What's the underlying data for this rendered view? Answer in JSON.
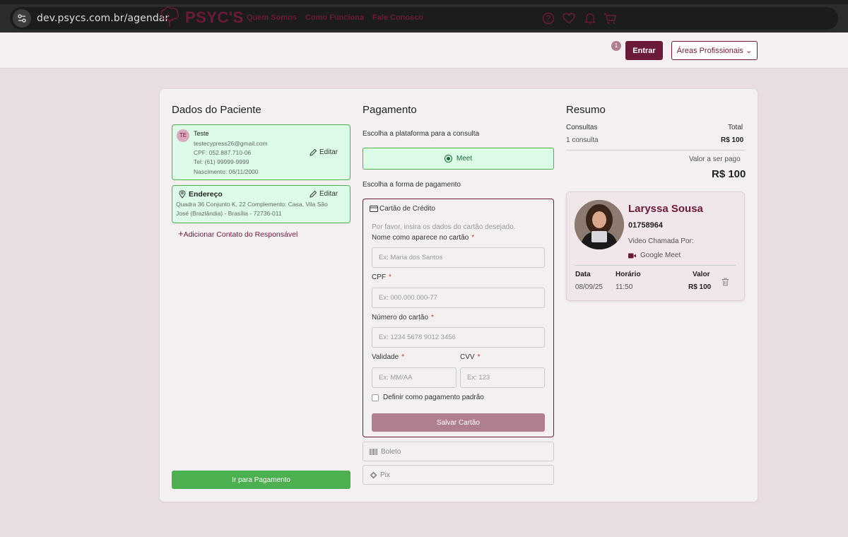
{
  "browser": {
    "url": "dev.psycs.com.br/agendar"
  },
  "header": {
    "brand": "PSYC'S",
    "nav": [
      "Quem Somos",
      "Como Funciona",
      "Fale Conosco"
    ],
    "cart_count": "1",
    "login_label": "Entrar",
    "areas_label": "Áreas Profissionais"
  },
  "patient": {
    "title": "Dados do Paciente",
    "initials": "TE",
    "name": "Teste",
    "email": "testecypress26@gmail.com",
    "cpf": "CPF: 052.887.710-06",
    "tel": "Tel: (61) 99999-9999",
    "birth": "Nascimento: 06/11/2000",
    "edit_label": "Editar",
    "address_title": "Endereço",
    "address_line1": "Quadra 36 Conjunto K, 22 Complemento: Casa, Vila São",
    "address_line2": "José (Brazlândia) - Brasília - 72736-011",
    "add_contact": "Adicionar Contato do Responsável",
    "go_payment": "Ir para Pagamento"
  },
  "payment": {
    "title": "Pagamento",
    "platform_label": "Escolha a plataforma para a consulta",
    "platform_option": "Meet",
    "method_label": "Escolha a forma de pagamento",
    "card_title": "Cartão de Crédito",
    "card_hint": "Por favor, insira os dados do cartão desejado.",
    "name_label": "Nome como aparece no cartão",
    "name_placeholder": "Ex: Maria dos Santos",
    "cpf_label": "CPF",
    "cpf_placeholder": "Ex: 000.000.000-77",
    "number_label": "Número do cartão",
    "number_placeholder": "Ex: 1234 5678 9012 3456",
    "validity_label": "Validade",
    "validity_placeholder": "Ex: MM/AA",
    "cvv_label": "CVV",
    "cvv_placeholder": "Ex: 123",
    "required_mark": "*",
    "default_label": "Definir como pagamento padrão",
    "save_label": "Salvar Cartão",
    "boleto_label": "Boleto",
    "pix_label": "Pix"
  },
  "summary": {
    "title": "Resumo",
    "consultas_label": "Consultas",
    "total_label": "Total",
    "count_text": "1 consulta",
    "total_value": "R$ 100",
    "to_pay_label": "Valor a ser pago",
    "to_pay_value": "R$ 100",
    "professional": {
      "name": "Laryssa Sousa",
      "register": "01758964",
      "call_label": "Video Chamada Por:",
      "call_platform": "Google Meet",
      "date_header": "Data",
      "time_header": "Horário",
      "value_header": "Valor",
      "date": "08/09/25",
      "time": "11:50",
      "value": "R$ 100"
    }
  },
  "colors": {
    "brand": "#6b1a3a",
    "success": "#4caf50",
    "success_bg": "#dcfce7",
    "muted_brand": "#b07f8e"
  }
}
